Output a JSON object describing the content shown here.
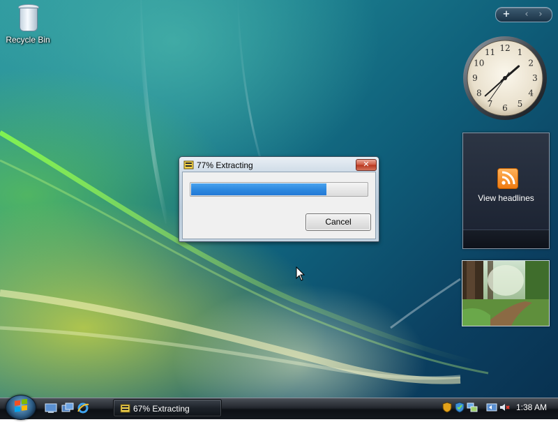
{
  "desktop": {
    "icons": [
      {
        "label": "Recycle Bin",
        "icon": "recycle-bin-icon"
      }
    ]
  },
  "sidebar": {
    "controls": {
      "add": "+",
      "prev": "‹",
      "next": "›"
    },
    "clock": {
      "numerals": [
        "12",
        "1",
        "2",
        "3",
        "4",
        "5",
        "6",
        "7",
        "8",
        "9",
        "10",
        "11"
      ],
      "time": "1:38"
    },
    "feed": {
      "label": "View headlines",
      "icon": "rss-feed-icon"
    },
    "slideshow": {
      "subject": "forest-path-photo"
    }
  },
  "dialog": {
    "title": "77% Extracting",
    "icon": "archive-icon",
    "close_label": "✕",
    "progress_percent": 77,
    "cancel_label": "Cancel"
  },
  "taskbar": {
    "start_icon": "windows-logo-icon",
    "quick_launch": [
      "show-desktop-icon",
      "switch-windows-icon",
      "internet-explorer-icon"
    ],
    "app_button": {
      "label": "67% Extracting",
      "icon": "archive-icon"
    },
    "tray_icons": [
      "security-shield-icon",
      "windows-update-icon",
      "network-icon",
      "sync-icon",
      "muted-volume-icon"
    ],
    "clock": "1:38 AM"
  },
  "colors": {
    "accent_progress": "#2e89e0",
    "close_button": "#c84a33",
    "feed_orange": "#f07a10"
  }
}
